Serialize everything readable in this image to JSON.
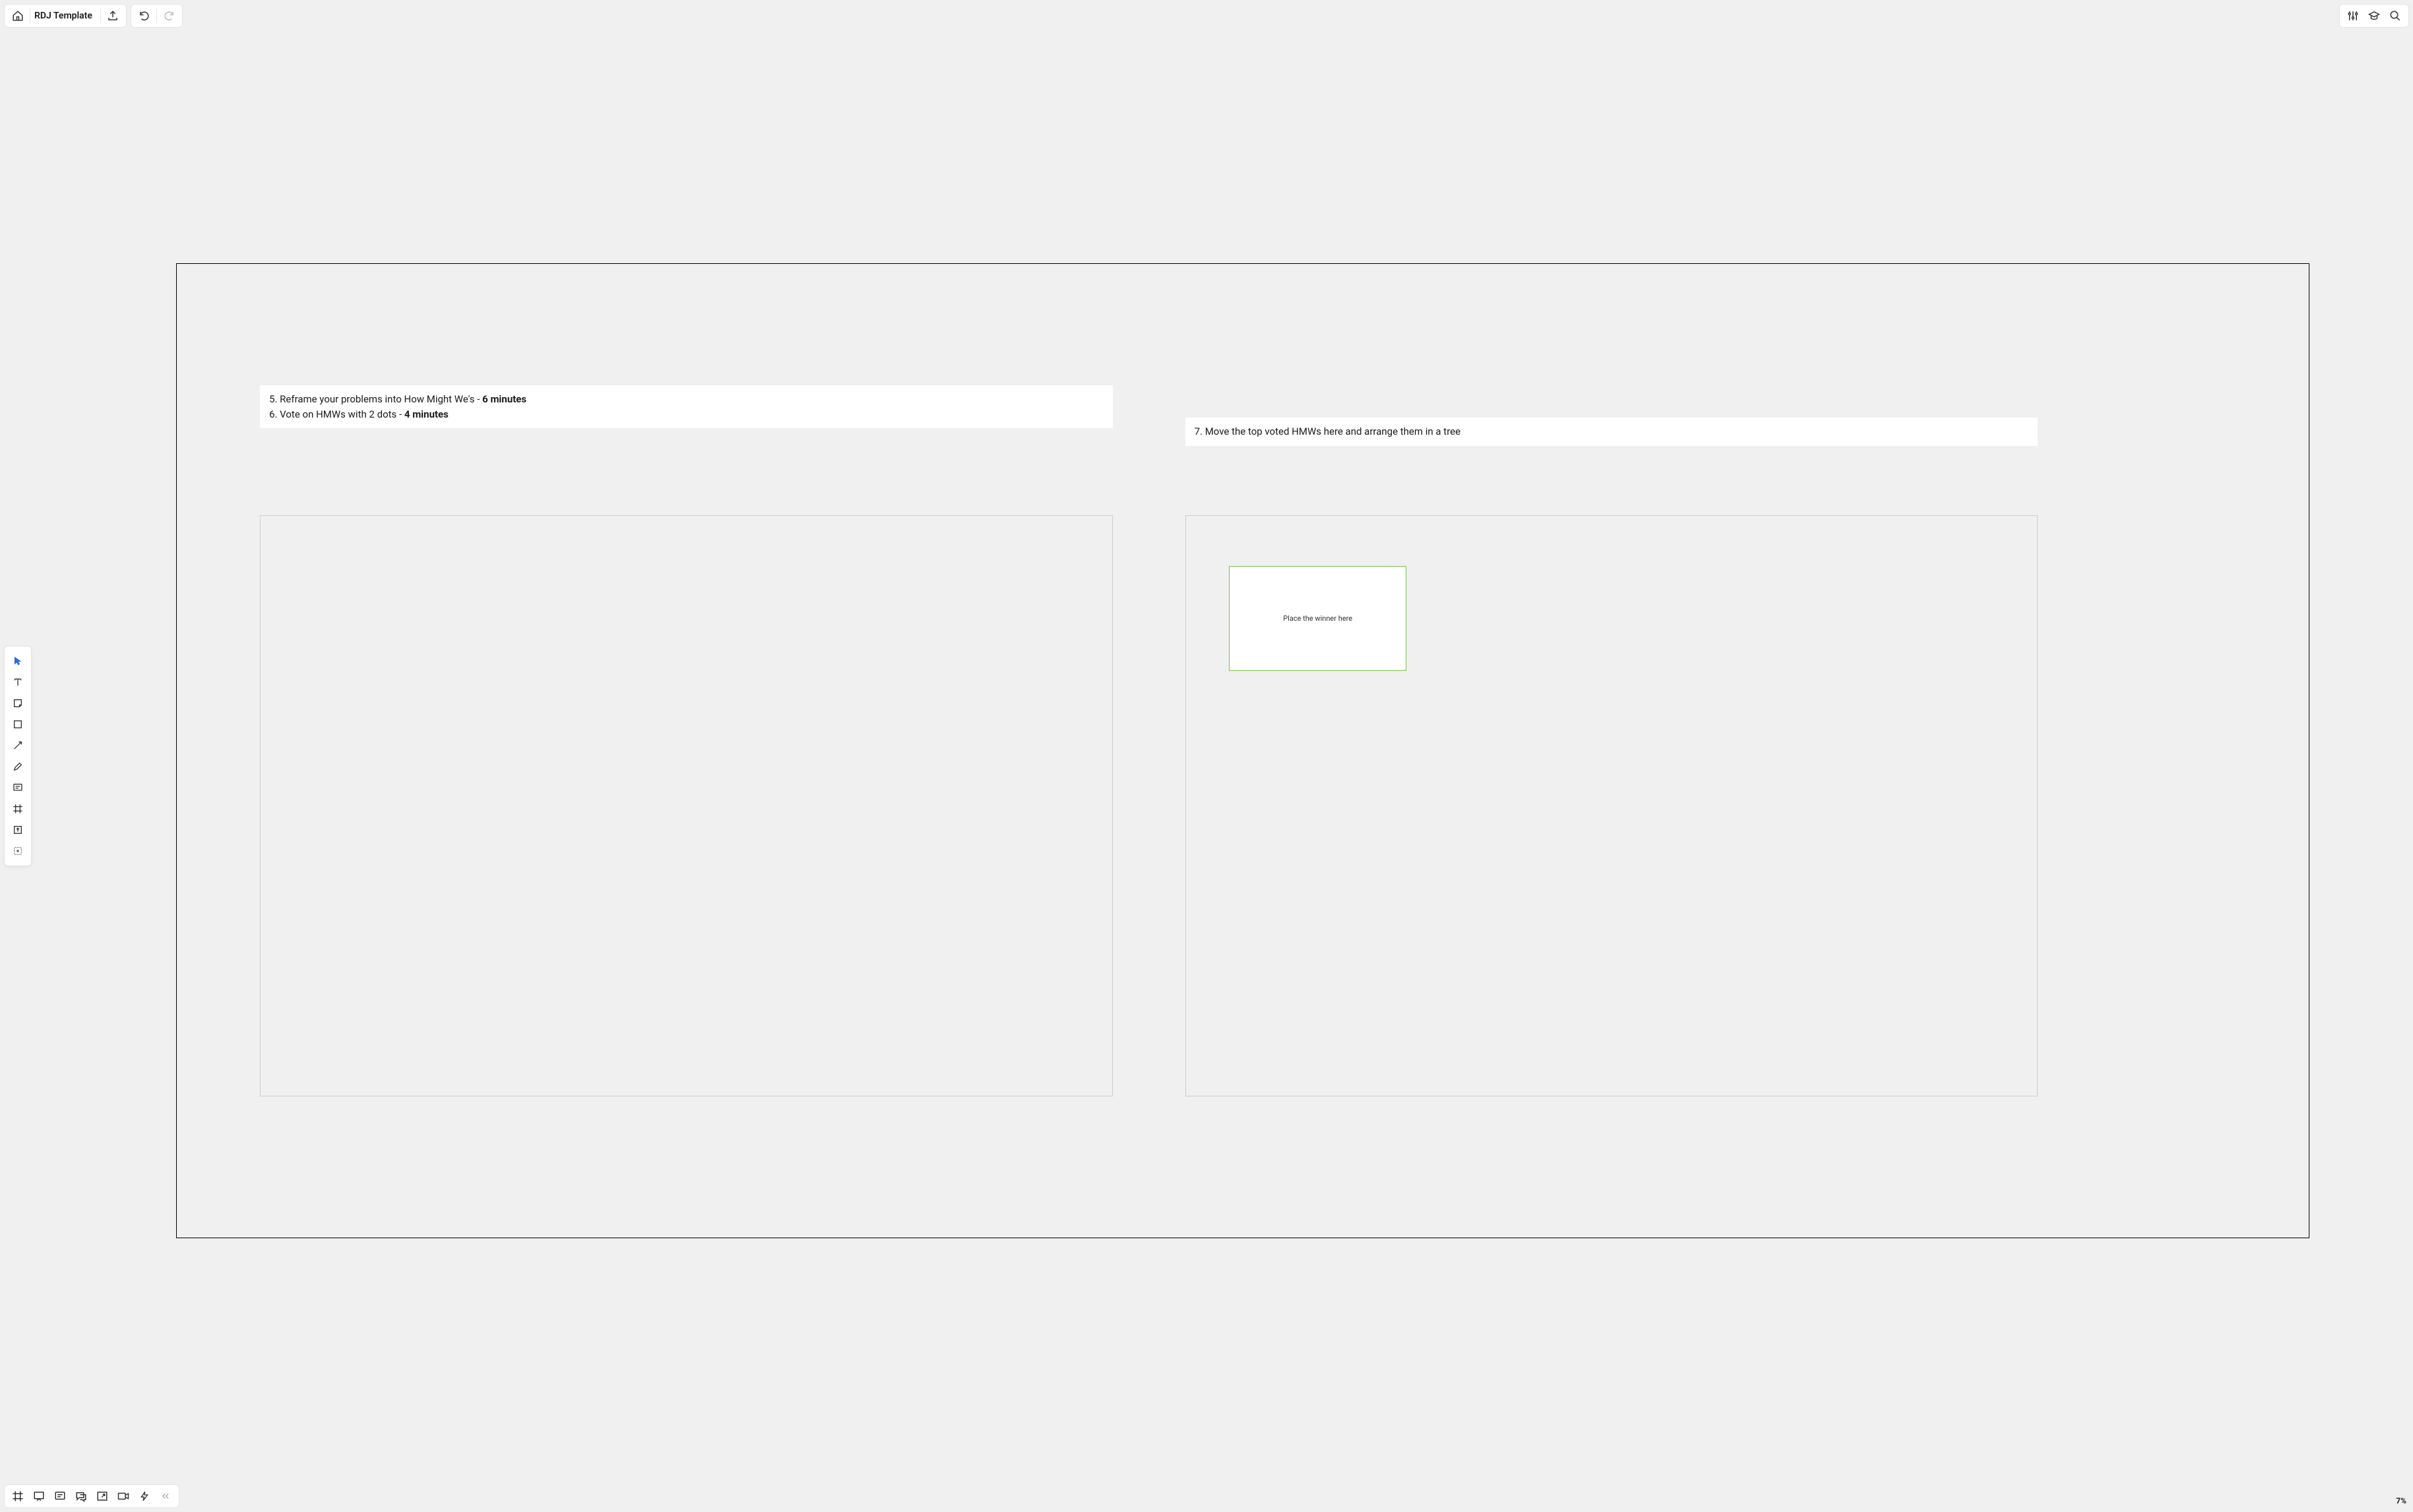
{
  "header": {
    "board_title": "RDJ Template"
  },
  "canvas": {
    "instruction_left": {
      "line1_prefix": "5. Reframe your problems into How Might We's - ",
      "line1_bold": "6 minutes",
      "line2_prefix": "6. Vote on HMWs with 2 dots - ",
      "line2_bold": "4 minutes"
    },
    "instruction_right": "7. Move the top voted HMWs here and arrange them in a tree",
    "winner_box_label": "Place the winner here"
  },
  "zoom": {
    "level": "7%"
  },
  "tools": {
    "select": "select-tool",
    "text": "text-tool",
    "sticky": "sticky-note-tool",
    "shape": "shape-tool",
    "line": "connection-line-tool",
    "pen": "pen-tool",
    "comment": "comment-tool",
    "frame": "frame-tool",
    "upload": "upload-tool",
    "more": "more-tools"
  },
  "bottom_tools": {
    "frames": "frames-panel",
    "present": "presentation-mode",
    "comments": "comments-panel",
    "chat": "chat-panel",
    "share": "screen-share",
    "video": "video-chat",
    "activity": "activities",
    "collapse": "collapse-toolbar"
  },
  "top_right": {
    "settings": "settings",
    "learn": "learning-center",
    "search": "search"
  }
}
